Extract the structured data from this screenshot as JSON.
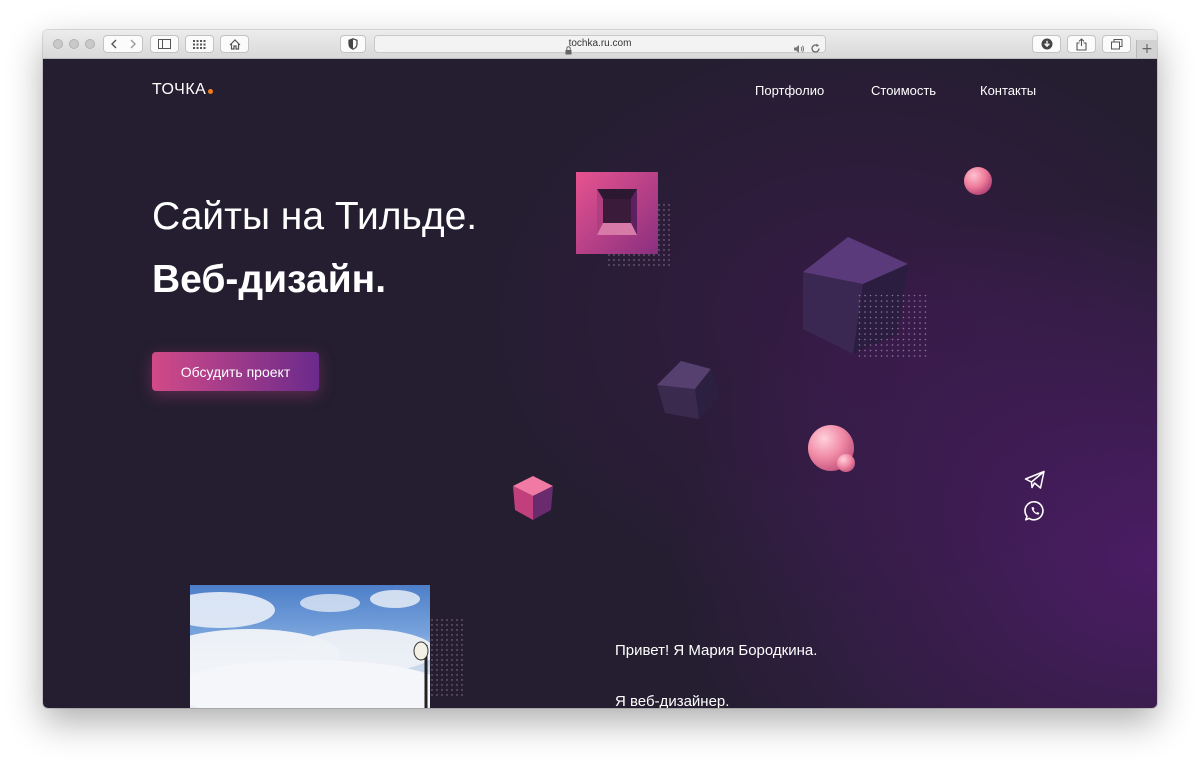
{
  "browser": {
    "url": "tochka.ru.com",
    "icons": [
      "back-icon",
      "forward-icon",
      "sidebar-icon",
      "top-sites-icon",
      "home-icon",
      "privacy-shield-icon",
      "lock-icon",
      "speaker-icon",
      "reload-icon",
      "download-icon",
      "share-icon",
      "tabs-icon",
      "new-tab-icon"
    ],
    "new_tab_label": "+"
  },
  "site": {
    "logo": "ТОЧКА",
    "logo_dot_color": "#f07c1e",
    "nav": [
      "Портфолио",
      "Стоимость",
      "Контакты"
    ],
    "headline_line1": "Сайты на Тильде.",
    "headline_line2": "Веб-дизайн.",
    "cta_label": "Обсудить проект",
    "social_icons": [
      "telegram-icon",
      "whatsapp-icon"
    ],
    "intro_line1": "Привет! Я Мария Бородкина.",
    "intro_line2": "Я веб-дизайнер."
  },
  "colors": {
    "page_background": "#241e30",
    "accent_pink": "#d14a88",
    "accent_purple": "#6b2a8c"
  }
}
